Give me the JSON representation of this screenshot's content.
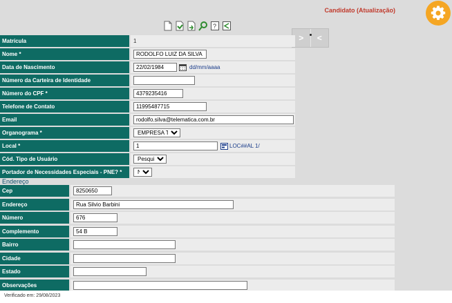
{
  "header": {
    "title": "Candidato (Atualização)",
    "gear_icon": "gear-icon",
    "accent_color": "#f5a623"
  },
  "toolbar": {
    "icons": [
      "new-document-icon",
      "save-icon",
      "export-icon",
      "search-icon",
      "help-icon",
      "share-icon"
    ]
  },
  "nav": {
    "next_label": ">",
    "prev_label": "<"
  },
  "form": {
    "matricula": {
      "label": "Matrícula",
      "value": "1"
    },
    "nome": {
      "label": "Nome *",
      "value": "RODOLFO LUIZ DA SILVA"
    },
    "nascimento": {
      "label": "Data de Nascimento",
      "value": "22/02/1984",
      "hint": "dd/mm/aaaa"
    },
    "identidade": {
      "label": "Número da Carteira de Identidade",
      "value": ""
    },
    "cpf": {
      "label": "Número do CPF *",
      "value": "4379235416"
    },
    "telefone": {
      "label": "Telefone de Contato",
      "value": "11995487715"
    },
    "email": {
      "label": "Email",
      "value": "rodolfo.silva@telematica.com.br"
    },
    "organograma": {
      "label": "Organograma *",
      "value": "EMPRESA TSI."
    },
    "local": {
      "label": "Local *",
      "value": "1",
      "lookup": "LOC##AL 1/"
    },
    "tipo_usuario": {
      "label": "Cód. Tipo de Usuário",
      "value": "Pesquisar"
    },
    "pne": {
      "label": "Portador de Necessidades Especiais - PNE? *",
      "value": "Não"
    }
  },
  "endereco": {
    "title": "Endereço",
    "cep": {
      "label": "Cep",
      "value": "8250650"
    },
    "endereco": {
      "label": "Endereço",
      "value": "Rua Silvio Barbini"
    },
    "numero": {
      "label": "Número",
      "value": "676"
    },
    "complemento": {
      "label": "Complemento",
      "value": "54 B"
    },
    "bairro": {
      "label": "Bairro",
      "value": ""
    },
    "cidade": {
      "label": "Cidade",
      "value": ""
    },
    "estado": {
      "label": "Estado",
      "value": ""
    },
    "observacoes": {
      "label": "Observações",
      "value": ""
    }
  },
  "footer": {
    "text": "Verificado em: 29/08/2023"
  },
  "colors": {
    "label_bg": "#0e6b63",
    "title": "#c0392b"
  }
}
